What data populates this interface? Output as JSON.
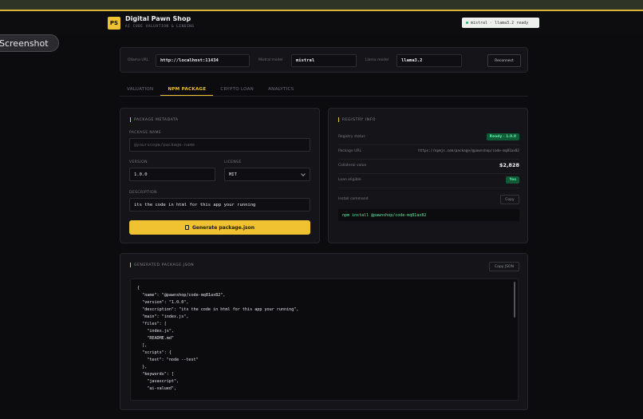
{
  "app": {
    "logo_text": "PS",
    "title": "Digital Pawn Shop",
    "tagline": "AI CODE VALUATION & LENDING",
    "status": "mistral · llama3.2 ready",
    "status_color": "#26b36a",
    "overlay_label": "Screenshot"
  },
  "config": {
    "ollama_label": "Ollama URL",
    "ollama_value": "http://localhost:11434",
    "mistral_label": "Mistral model",
    "mistral_value": "mistral",
    "llama_label": "Llama model",
    "llama_value": "llama3.2",
    "reconnect_label": "Reconnect"
  },
  "tabs": [
    {
      "label": "VALUATION",
      "active": false
    },
    {
      "label": "NPM PACKAGE",
      "active": true
    },
    {
      "label": "CRYPTO LOAN",
      "active": false
    },
    {
      "label": "ANALYTICS",
      "active": false
    }
  ],
  "metadata": {
    "section_title": "PACKAGE METADATA",
    "name_label": "PACKAGE NAME",
    "name_placeholder": "@yourscope/package-name",
    "version_label": "VERSION",
    "version_value": "1.0.0",
    "license_label": "LICENSE",
    "license_value": "MIT",
    "description_label": "DESCRIPTION",
    "description_value": "its the code in html for this app your running",
    "generate_label": "Generate package.json"
  },
  "registry": {
    "section_title": "REGISTRY INFO",
    "status_label": "Registry status",
    "status_value": "Ready · 1.0.0",
    "url_label": "Package URL",
    "url_value": "https://npmjs.com/package/@pawnshop/code-mq81ax82",
    "collateral_label": "Collateral value",
    "collateral_value": "$2,828",
    "loan_label": "Loan eligible",
    "loan_value": "Yes",
    "install_label": "Install command",
    "copy_label": "Copy",
    "install_command": "npm install @pawnshop/code-mq81ax82"
  },
  "generated": {
    "section_title": "GENERATED PACKAGE.JSON",
    "copy_label": "Copy JSON",
    "lines": [
      "{",
      "  \"name\": \"@pawnshop/code-mq81ax82\",",
      "  \"version\": \"1.0.0\",",
      "  \"description\": \"its the code in html for this app your running\",",
      "  \"main\": \"index.js\",",
      "  \"files\": [",
      "    \"index.js\",",
      "    \"README.md\"",
      "  ],",
      "  \"scripts\": {",
      "    \"test\": \"node --test\"",
      "  },",
      "  \"keywords\": [",
      "    \"javascript\",",
      "    \"ai-valued\","
    ]
  }
}
